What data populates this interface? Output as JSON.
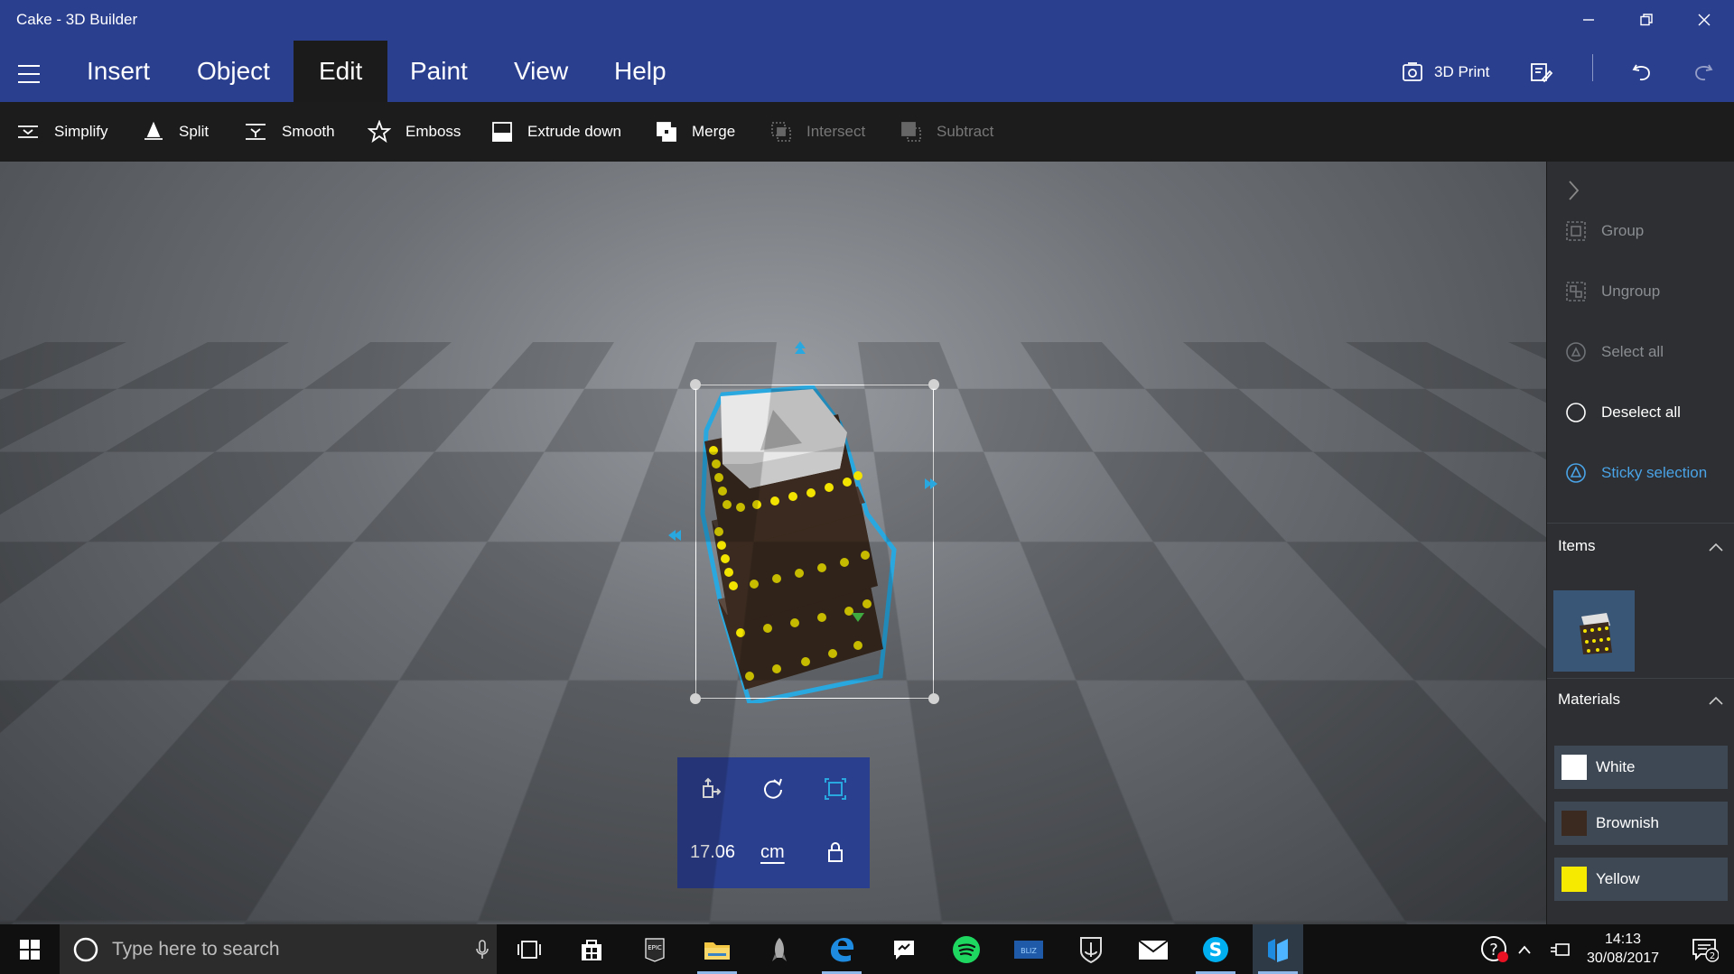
{
  "window": {
    "title": "Cake - 3D Builder"
  },
  "menu": {
    "tabs": [
      {
        "label": "Insert"
      },
      {
        "label": "Object"
      },
      {
        "label": "Edit",
        "active": true
      },
      {
        "label": "Paint"
      },
      {
        "label": "View"
      },
      {
        "label": "Help"
      }
    ],
    "print_label": "3D Print"
  },
  "toolbar": {
    "tools": [
      {
        "label": "Simplify",
        "icon": "simplify-icon",
        "enabled": true
      },
      {
        "label": "Split",
        "icon": "split-icon",
        "enabled": true
      },
      {
        "label": "Smooth",
        "icon": "smooth-icon",
        "enabled": true
      },
      {
        "label": "Emboss",
        "icon": "star-icon",
        "enabled": true
      },
      {
        "label": "Extrude down",
        "icon": "extrude-down-icon",
        "enabled": true
      },
      {
        "label": "Merge",
        "icon": "merge-icon",
        "enabled": true
      },
      {
        "label": "Intersect",
        "icon": "intersect-icon",
        "enabled": false
      },
      {
        "label": "Subtract",
        "icon": "subtract-icon",
        "enabled": false
      }
    ]
  },
  "transform": {
    "value": "17.06",
    "unit": "cm"
  },
  "panel": {
    "actions": [
      {
        "label": "Group",
        "state": "disabled"
      },
      {
        "label": "Ungroup",
        "state": "disabled"
      },
      {
        "label": "Select all",
        "state": "disabled"
      },
      {
        "label": "Deselect all",
        "state": "enabled"
      },
      {
        "label": "Sticky selection",
        "state": "active"
      }
    ],
    "items_title": "Items",
    "materials_title": "Materials",
    "materials": [
      {
        "label": "White",
        "color": "#ffffff"
      },
      {
        "label": "Brownish",
        "color": "#3a2a1f"
      },
      {
        "label": "Yellow",
        "color": "#f5ea00"
      }
    ]
  },
  "taskbar": {
    "search_placeholder": "Type here to search",
    "time": "14:13",
    "date": "30/08/2017",
    "notification_count": "2"
  },
  "colors": {
    "accent": "#2b3f8f",
    "selection": "#29a8e0",
    "toolbar_bg": "#1c1c1c"
  }
}
